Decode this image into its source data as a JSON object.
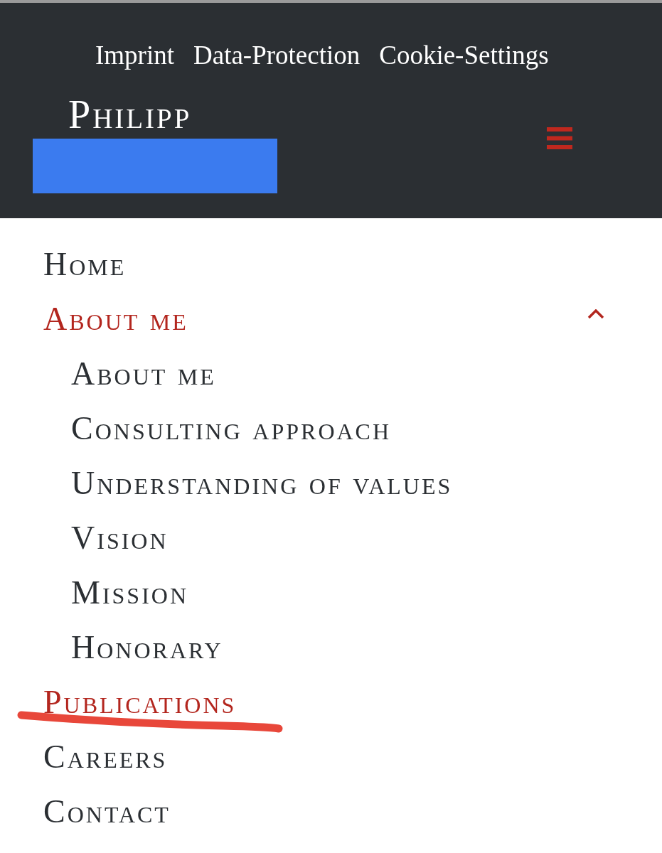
{
  "top_links": [
    "Imprint",
    "Data-Protection",
    "Cookie-Settings"
  ],
  "logo": {
    "text": "Philipp"
  },
  "menu": {
    "items": [
      {
        "label": "Home",
        "selected": false,
        "underlined": false
      },
      {
        "label": "About me",
        "selected": true,
        "underlined": false,
        "expanded": true,
        "children": [
          {
            "label": "About me",
            "selected": false
          },
          {
            "label": "Consulting approach",
            "selected": false
          },
          {
            "label": "Understanding of values",
            "selected": false
          },
          {
            "label": "Vision",
            "selected": false
          },
          {
            "label": "Mission",
            "selected": false
          },
          {
            "label": "Honorary",
            "selected": false
          }
        ]
      },
      {
        "label": "Publications",
        "selected": true,
        "underlined": true
      },
      {
        "label": "Careers",
        "selected": false,
        "underlined": false
      },
      {
        "label": "Contact",
        "selected": false,
        "underlined": false
      }
    ]
  }
}
